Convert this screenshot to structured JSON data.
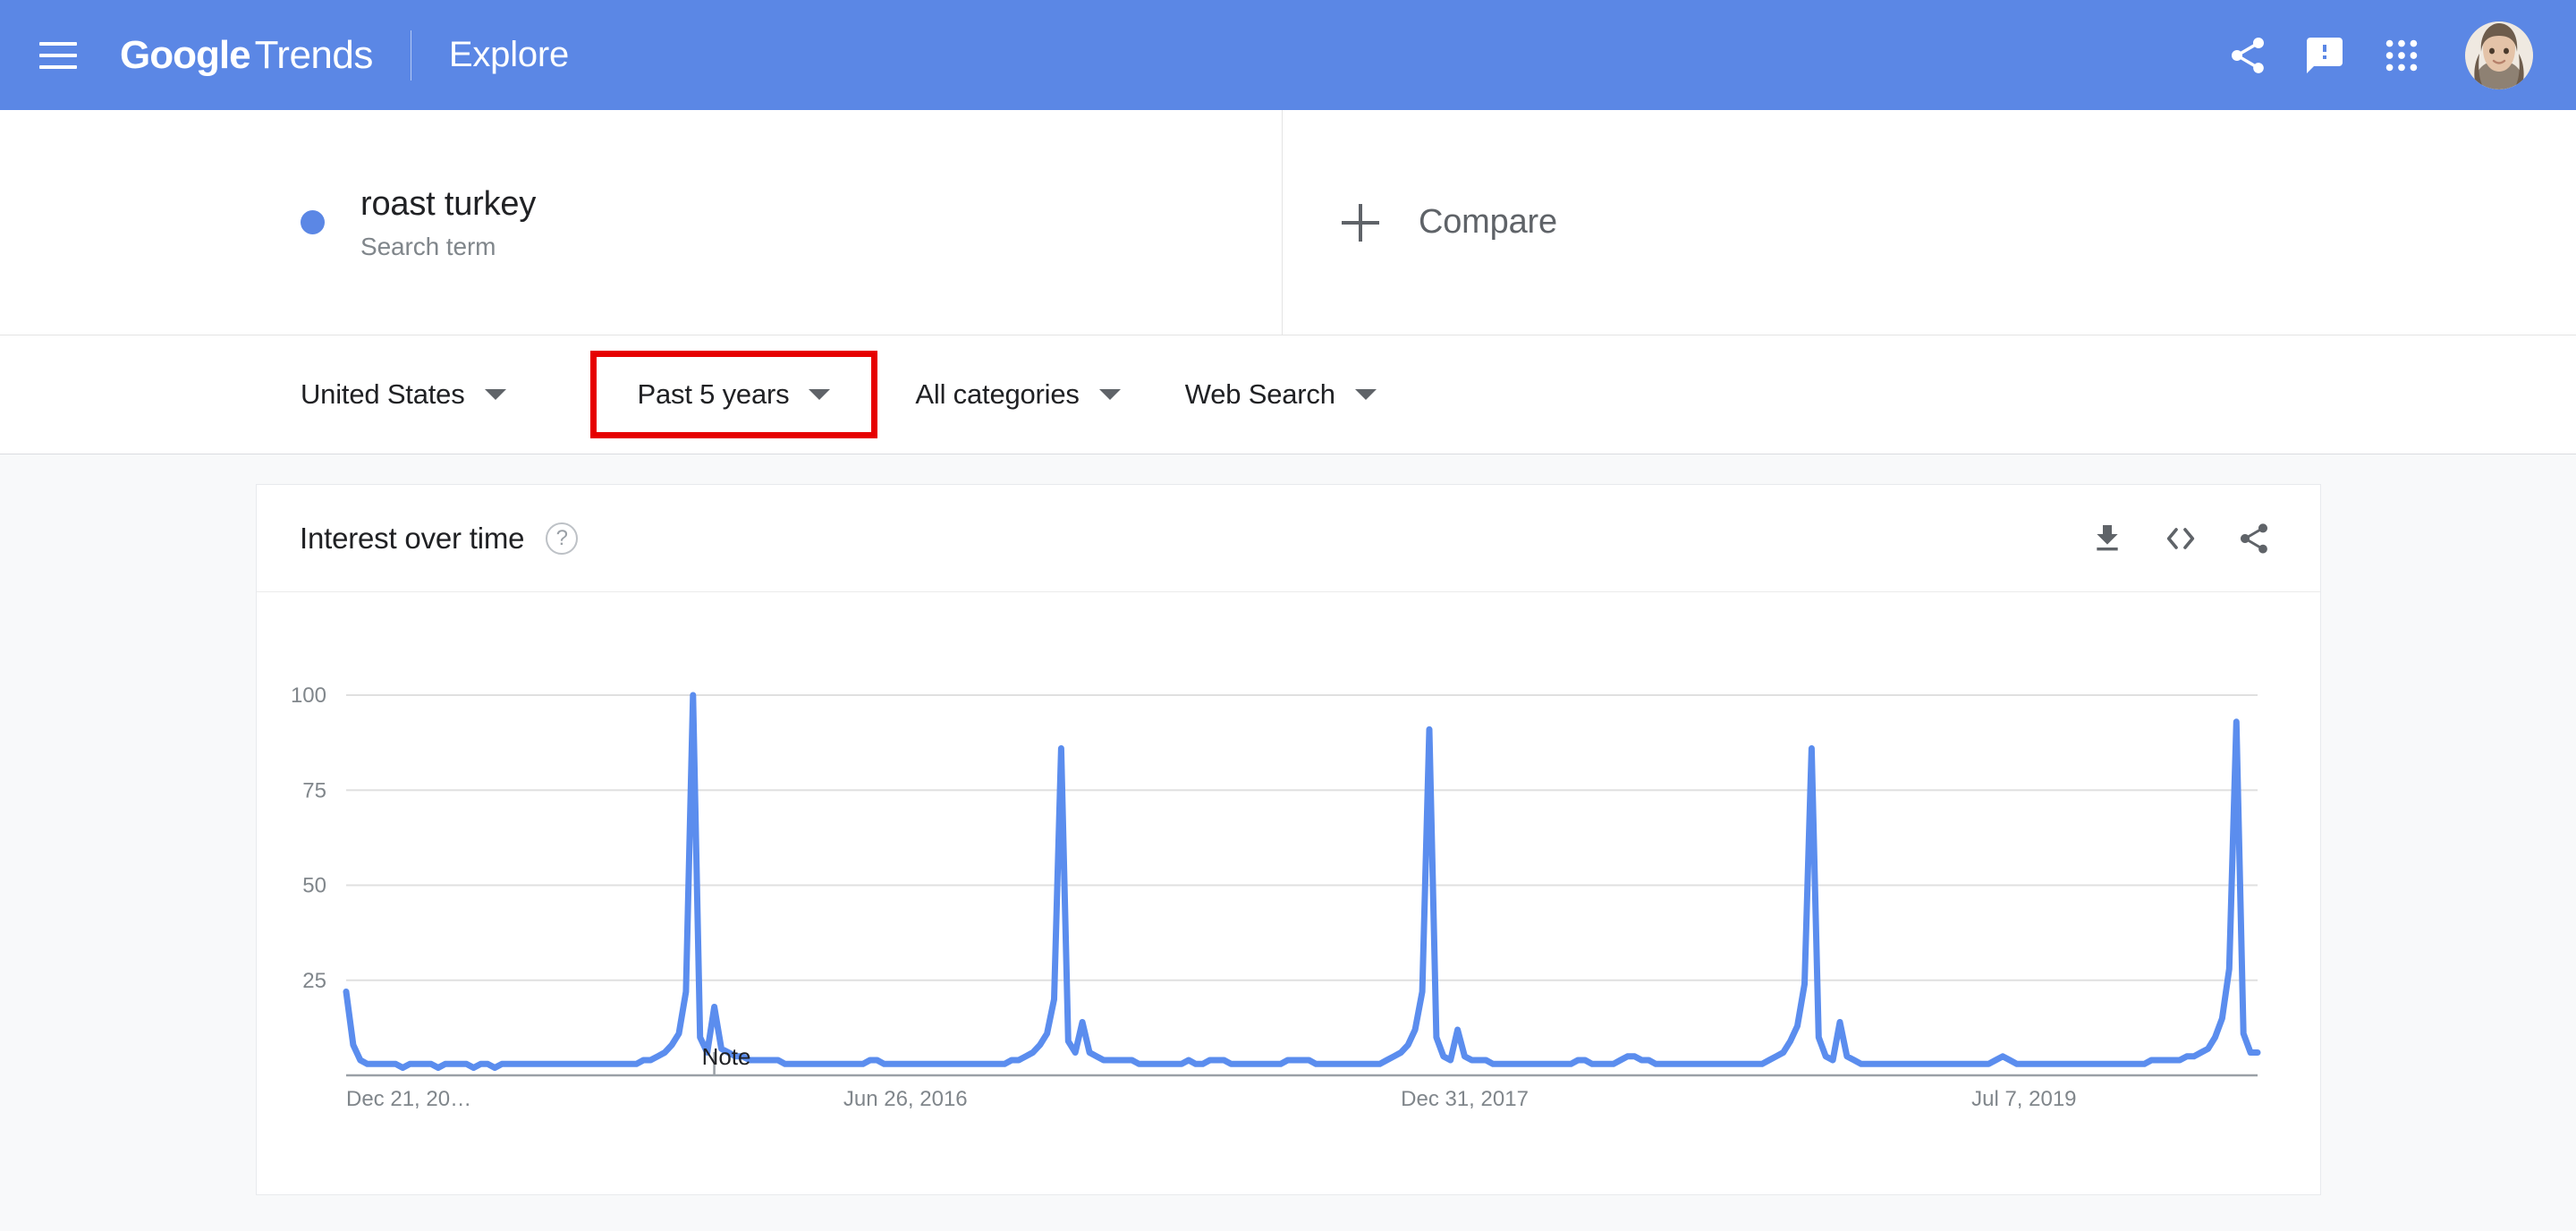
{
  "appbar": {
    "menu_icon": "hamburger-menu-icon",
    "brand_google": "Google",
    "brand_trends": "Trends",
    "explore": "Explore",
    "share_icon": "share-icon",
    "feedback_icon": "feedback-icon",
    "apps_icon": "apps-grid-icon",
    "avatar": "user-avatar",
    "bg_color": "#5b87e5"
  },
  "term": {
    "dot_color": "#5b87e5",
    "title": "roast turkey",
    "subtitle": "Search term",
    "compare_label": "Compare",
    "compare_plus": "plus-icon"
  },
  "filters": [
    {
      "label": "United States",
      "highlighted": false
    },
    {
      "label": "Past 5 years",
      "highlighted": true
    },
    {
      "label": "All categories",
      "highlighted": false
    },
    {
      "label": "Web Search",
      "highlighted": false
    }
  ],
  "highlight_color": "#e60000",
  "card": {
    "title": "Interest over time",
    "help_icon": "help-circle-icon",
    "download_icon": "download-icon",
    "embed_icon": "embed-code-icon",
    "share_icon": "share-icon"
  },
  "chart_data": {
    "type": "line",
    "title": "Interest over time",
    "xlabel": "",
    "ylabel": "",
    "ylim": [
      0,
      100
    ],
    "yticks": [
      100,
      75,
      50,
      25
    ],
    "grid": true,
    "legend_position": "none",
    "line_color": "#5b8dee",
    "annotations": [
      {
        "label": "Note",
        "x_index": 52
      }
    ],
    "xtick_labels": [
      "Dec 21, 20…",
      "Jun 26, 2016",
      "Dec 31, 2017",
      "Jul 7, 2019"
    ],
    "xtick_positions": [
      0,
      79,
      158,
      237
    ],
    "series": [
      {
        "name": "roast turkey",
        "values": [
          22,
          8,
          4,
          3,
          3,
          3,
          3,
          3,
          2,
          3,
          3,
          3,
          3,
          2,
          3,
          3,
          3,
          3,
          2,
          3,
          3,
          2,
          3,
          3,
          3,
          3,
          3,
          3,
          3,
          3,
          3,
          3,
          3,
          3,
          3,
          3,
          3,
          3,
          3,
          3,
          3,
          3,
          4,
          4,
          5,
          6,
          8,
          11,
          22,
          100,
          10,
          6,
          18,
          7,
          6,
          5,
          5,
          4,
          4,
          4,
          4,
          4,
          3,
          3,
          3,
          3,
          3,
          3,
          3,
          3,
          3,
          3,
          3,
          3,
          4,
          4,
          3,
          3,
          3,
          3,
          3,
          3,
          3,
          3,
          3,
          3,
          3,
          3,
          3,
          3,
          3,
          3,
          3,
          3,
          4,
          4,
          5,
          6,
          8,
          11,
          20,
          86,
          9,
          6,
          14,
          6,
          5,
          4,
          4,
          4,
          4,
          4,
          3,
          3,
          3,
          3,
          3,
          3,
          3,
          4,
          3,
          3,
          4,
          4,
          4,
          3,
          3,
          3,
          3,
          3,
          3,
          3,
          3,
          4,
          4,
          4,
          4,
          3,
          3,
          3,
          3,
          3,
          3,
          3,
          3,
          3,
          3,
          4,
          5,
          6,
          8,
          12,
          22,
          91,
          10,
          5,
          4,
          12,
          5,
          4,
          4,
          4,
          3,
          3,
          3,
          3,
          3,
          3,
          3,
          3,
          3,
          3,
          3,
          3,
          4,
          4,
          3,
          3,
          3,
          3,
          4,
          5,
          5,
          4,
          4,
          3,
          3,
          3,
          3,
          3,
          3,
          3,
          3,
          3,
          3,
          3,
          3,
          3,
          3,
          3,
          3,
          4,
          5,
          6,
          9,
          13,
          24,
          86,
          10,
          5,
          4,
          14,
          5,
          4,
          3,
          3,
          3,
          3,
          3,
          3,
          3,
          3,
          3,
          3,
          3,
          3,
          3,
          3,
          3,
          3,
          3,
          3,
          3,
          4,
          5,
          4,
          3,
          3,
          3,
          3,
          3,
          3,
          3,
          3,
          3,
          3,
          3,
          3,
          3,
          3,
          3,
          3,
          3,
          3,
          3,
          4,
          4,
          4,
          4,
          4,
          5,
          5,
          6,
          7,
          10,
          15,
          28,
          93,
          11,
          6,
          6
        ]
      }
    ]
  }
}
